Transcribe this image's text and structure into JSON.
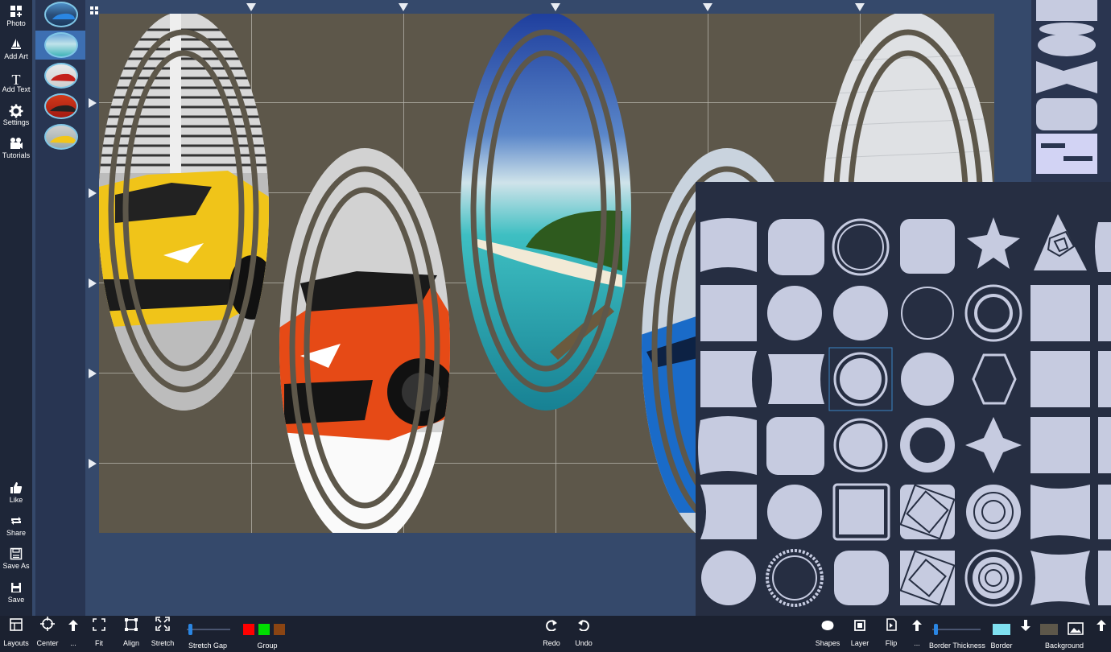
{
  "sidebar": {
    "items": [
      {
        "label": "Photo",
        "icon": "add-photo-icon"
      },
      {
        "label": "Add Art",
        "icon": "art-icon"
      },
      {
        "label": "Add Text",
        "icon": "text-icon"
      },
      {
        "label": "Settings",
        "icon": "gear-icon"
      },
      {
        "label": "Tutorials",
        "icon": "camera-icon"
      }
    ],
    "bottom_items": [
      {
        "label": "Like",
        "icon": "thumbs-up-icon"
      },
      {
        "label": "Share",
        "icon": "share-icon"
      },
      {
        "label": "Save As",
        "icon": "save-as-icon"
      },
      {
        "label": "Save",
        "icon": "save-icon"
      }
    ]
  },
  "thumbnails": [
    "blue-car",
    "beach",
    "red-car",
    "red-car-2",
    "yellow-car"
  ],
  "toolbar": {
    "layouts": "Layouts",
    "center": "Center",
    "up_more": "...",
    "fit": "Fit",
    "align": "Align",
    "stretch": "Stretch",
    "stretch_gap": "Stretch Gap",
    "stretch_gap_value": 0,
    "group": "Group",
    "group_colors": [
      "#ff0000",
      "#00dd00",
      "#8b4513"
    ],
    "redo": "Redo",
    "undo": "Undo",
    "shapes": "Shapes",
    "layer": "Layer",
    "flip": "Flip",
    "up_more2": "...",
    "border_thickness": "Border Thickness",
    "border_thickness_value": 0,
    "border": "Border",
    "border_color": "#7fe0f0",
    "background": "Background",
    "background_color": "#5d574a"
  },
  "colors": {
    "canvas_bg": "#5d574a",
    "accent": "#2a86e3",
    "panel_bg": "#262e42",
    "shape_fill": "#c6cbe0"
  }
}
